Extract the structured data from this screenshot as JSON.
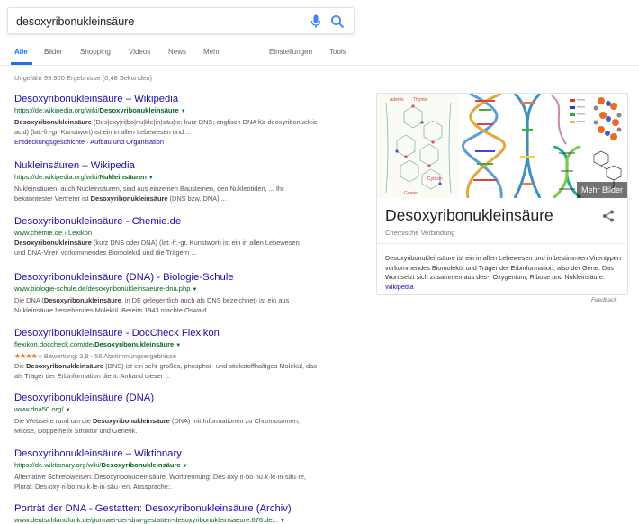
{
  "search": {
    "query": "desoxyribonukleinsäure"
  },
  "tabs": [
    {
      "label": "Alle"
    },
    {
      "label": "Bilder"
    },
    {
      "label": "Shopping"
    },
    {
      "label": "Videos"
    },
    {
      "label": "News"
    },
    {
      "label": "Mehr"
    },
    {
      "label": "Einstellungen"
    },
    {
      "label": "Tools"
    }
  ],
  "stats": "Ungefähr 99.900 Ergebnisse (0,48 Sekunden)",
  "results": [
    {
      "title": "Desoxyribonukleinsäure – Wikipedia",
      "url_prefix": "https://de.wikipedia.org/wiki/",
      "url_bold": "Desoxyribonukleinsäure",
      "snippet_1_bold": "Desoxyribonukleinsäure",
      "snippet_1_rest": " (Des|oxy|ri|bo|nu|kle|in|säu|re; kurz DNS; englisch DNA für deoxyribonucleic",
      "snippet_2": "acid) (lat.-fr.-gr. Kunstwort) ist ein in allen Lebewesen und ...",
      "sublink_1": "Entdeckungsgeschichte",
      "sublink_sep": " · ",
      "sublink_2": "Aufbau und Organisation"
    },
    {
      "title": "Nukleinsäuren – Wikipedia",
      "url_prefix": "https://de.wikipedia.org/wiki/",
      "url_bold": "Nukleinsäuren",
      "snippet_1": "Nukleinsäuren, auch Nucleinsäuren, sind aus einzelnen Bausteinen, den Nukleotiden, ... Ihr",
      "snippet_2_pre": "bekanntester Vertreter ist ",
      "snippet_2_bold": "Desoxyribonukleinsäure",
      "snippet_2_post": " (DNS bzw. DNA) ..."
    },
    {
      "title": "Desoxyribonukleinsäure - Chemie.de",
      "url": "www.chemie.de › Lexikon",
      "snippet_1_bold": "Desoxyribonukleinsäure",
      "snippet_1_rest": " (kurz DNS oder DNA) (lat.-fr.-gr. Kunstwort) ist ein in allen Lebewesen",
      "snippet_2": "und DNA-Viren vorkommendes Biomolekül und die Trägern ..."
    },
    {
      "title": "Desoxyribonukleinsäure (DNA) - Biologie-Schule",
      "url": "www.biologie-schule.de/desoxyribonukleinsaeure-dna.php",
      "snippet_1_pre": "Die DNA (",
      "snippet_1_bold": "Desoxyribonukleinsäure",
      "snippet_1_post": ", in DE gelegentlich auch als DNS bezeichnet) ist ein aus",
      "snippet_2": "Nukleinsäure bestehendes Molekül. Bereits 1943 machte Oswald ..."
    },
    {
      "title": "Desoxyribonukleinsäure - DocCheck Flexikon",
      "url_prefix": "flexikon.doccheck.com/de/",
      "url_bold": "Desoxyribonukleinsäure",
      "stars": "★★★★",
      "star_empty": "★",
      "rating": "Bewertung: 3,9 - 56 Abstimmungsergebnisse",
      "snippet_1_pre": "Die ",
      "snippet_1_bold": "Desoxyribonukleinsäure",
      "snippet_1_post": " (DNS) ist ein sehr großes, phosphor- und stickstoffhaltiges Molekül, das",
      "snippet_2": "als Träger der Erbinformation dient. Anhand dieser ..."
    },
    {
      "title": "Desoxyribonukleinsäure (DNA)",
      "url": "www.dna50.org/",
      "snippet_1_pre": "Die Webseite rund um die ",
      "snippet_1_bold": "Desoxyribonukleinsäure",
      "snippet_1_post": " (DNA) mit Informationen zu Chromosomen,",
      "snippet_2": "Mitose, Doppelhelix Struktur und Genetik."
    },
    {
      "title": "Desoxyribonukleinsäure – Wiktionary",
      "url_prefix": "https://de.wiktionary.org/wiki/",
      "url_bold": "Desoxyribonukleinsäure",
      "snippet_1": "Alternative Schreibweisen: Desoxyribonucleinsäure. Worttrennung: Des·oxy·ri·bo·nu·k·le·in·säu·re,",
      "snippet_2": "Plural: Des·oxy·ri·bo·nu·k·le·in·säu·ren. Aussprache:."
    },
    {
      "title": "Porträt der DNA - Gestatten: Desoxyribonukleinsäure (Archiv)",
      "url": "www.deutschlandfunk.de/portraet-der-dna-gestatten-desoxyribonukleinsaeure.676.de..."
    }
  ],
  "knowledge_panel": {
    "title": "Desoxyribonukleinsäure",
    "subtitle": "Chemische Verbindung",
    "more_images": "Mehr Bilder",
    "description": "Desoxyribonukleinsäure ist ein in allen Lebewesen und in bestimmten Virentypen vorkommendes Biomolekül und Träger der Erbinformation, also der Gene. Das Wort setzt sich zusammen aus des-, Oxygenium, Ribose und Nukleinsäure.",
    "source_link": "Wikipedia",
    "image_labels": [
      "Adenin",
      "Thymin",
      "Cytosin",
      "Guanin"
    ],
    "feedback": "Feedback"
  },
  "colors": {
    "link": "#1a0dab",
    "url": "#006621",
    "accent": "#1a73e8"
  },
  "icons": [
    "microphone-icon",
    "search-icon",
    "share-icon",
    "dropdown-caret-icon"
  ]
}
